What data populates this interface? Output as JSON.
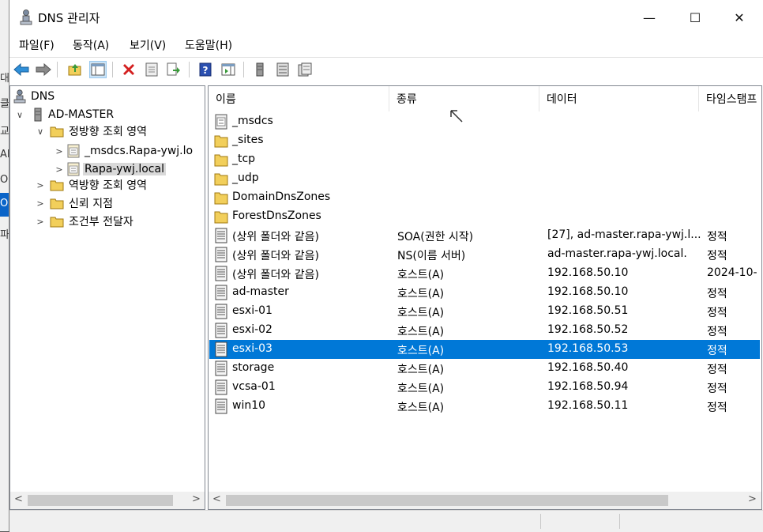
{
  "background": {
    "fragments": [
      "대",
      "클",
      "교",
      "Al",
      "O",
      "O",
      "파"
    ]
  },
  "window": {
    "title": "DNS 관리자",
    "minimize": "—",
    "maximize": "☐",
    "close": "✕"
  },
  "menu": [
    "파일(F)",
    "동작(A)",
    "보기(V)",
    "도움말(H)"
  ],
  "toolbar": [
    "back-icon",
    "forward-icon",
    "up-folder-icon",
    "show-tree-icon",
    "delete-icon",
    "properties-icon",
    "export-icon",
    "help-icon",
    "view-icon",
    "server-icon",
    "list-icon",
    "records-icon"
  ],
  "tree": {
    "root": "DNS",
    "server": "AD-MASTER",
    "forward_zones": "정방향 조회 영역",
    "zone1": "_msdcs.Rapa-ywj.lo",
    "zone2": "Rapa-ywj.local",
    "reverse_zones": "역방향 조회 영역",
    "trust_points": "신뢰 지점",
    "conditional_forwarders": "조건부 전달자"
  },
  "list": {
    "columns": [
      "이름",
      "종류",
      "데이터",
      "타임스탬프"
    ],
    "rows": [
      {
        "name": "_msdcs",
        "type": "",
        "data": "",
        "ts": "",
        "icon": "zone-folder-icon"
      },
      {
        "name": "_sites",
        "type": "",
        "data": "",
        "ts": "",
        "icon": "folder-icon"
      },
      {
        "name": "_tcp",
        "type": "",
        "data": "",
        "ts": "",
        "icon": "folder-icon"
      },
      {
        "name": "_udp",
        "type": "",
        "data": "",
        "ts": "",
        "icon": "folder-icon"
      },
      {
        "name": "DomainDnsZones",
        "type": "",
        "data": "",
        "ts": "",
        "icon": "folder-icon"
      },
      {
        "name": "ForestDnsZones",
        "type": "",
        "data": "",
        "ts": "",
        "icon": "folder-icon"
      },
      {
        "name": "(상위 폴더와 같음)",
        "type": "SOA(권한 시작)",
        "data": "[27], ad-master.rapa-ywj.l...",
        "ts": "정적",
        "icon": "record-icon"
      },
      {
        "name": "(상위 폴더와 같음)",
        "type": "NS(이름 서버)",
        "data": "ad-master.rapa-ywj.local.",
        "ts": "정적",
        "icon": "record-icon"
      },
      {
        "name": "(상위 폴더와 같음)",
        "type": "호스트(A)",
        "data": "192.168.50.10",
        "ts": "2024-10-",
        "icon": "record-icon"
      },
      {
        "name": "ad-master",
        "type": "호스트(A)",
        "data": "192.168.50.10",
        "ts": "정적",
        "icon": "record-icon"
      },
      {
        "name": "esxi-01",
        "type": "호스트(A)",
        "data": "192.168.50.51",
        "ts": "정적",
        "icon": "record-icon"
      },
      {
        "name": "esxi-02",
        "type": "호스트(A)",
        "data": "192.168.50.52",
        "ts": "정적",
        "icon": "record-icon"
      },
      {
        "name": "esxi-03",
        "type": "호스트(A)",
        "data": "192.168.50.53",
        "ts": "정적",
        "icon": "record-icon",
        "selected": true
      },
      {
        "name": "storage",
        "type": "호스트(A)",
        "data": "192.168.50.40",
        "ts": "정적",
        "icon": "record-icon"
      },
      {
        "name": "vcsa-01",
        "type": "호스트(A)",
        "data": "192.168.50.94",
        "ts": "정적",
        "icon": "record-icon"
      },
      {
        "name": "win10",
        "type": "호스트(A)",
        "data": "192.168.50.11",
        "ts": "정적",
        "icon": "record-icon"
      }
    ]
  },
  "scroll": {
    "left": "<",
    "right": ">"
  }
}
